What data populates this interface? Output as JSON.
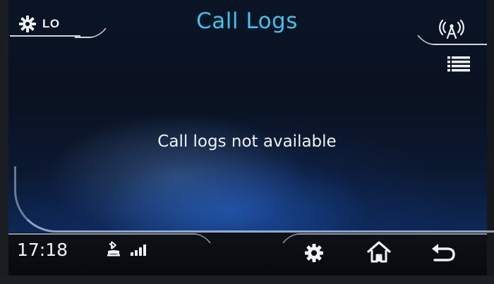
{
  "header": {
    "title": "Call Logs",
    "climate": {
      "fan_level_label": "LO",
      "icon": "fan-icon"
    },
    "antenna_icon": "antenna-icon",
    "menu_icon": "list-icon"
  },
  "main": {
    "message": "Call logs not available"
  },
  "status_bar": {
    "time": "17:18",
    "bluetooth_icon": "bluetooth-phone-icon",
    "signal_icon": "signal-strength-icon",
    "buttons": [
      {
        "name": "settings",
        "icon": "gear-icon"
      },
      {
        "name": "home",
        "icon": "home-icon"
      },
      {
        "name": "back",
        "icon": "back-arrow-icon"
      }
    ]
  },
  "colors": {
    "title": "#3cc3ee",
    "text": "#eef1f6",
    "accent_blue": "#2a6ee6"
  }
}
